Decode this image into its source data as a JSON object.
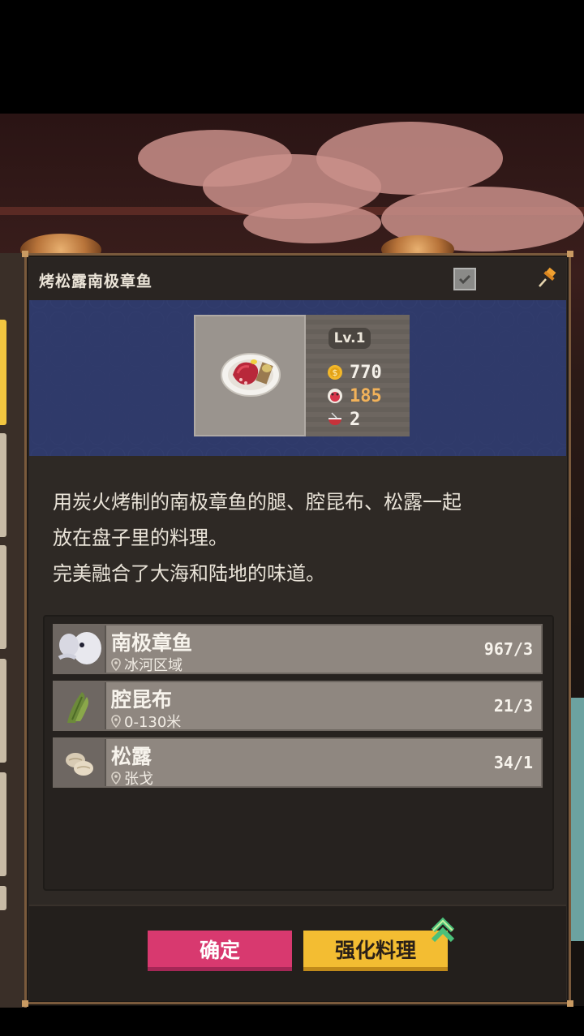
{
  "dish": {
    "title": "烤松露南极章鱼",
    "level": "Lv.1",
    "price": "770",
    "taste": "185",
    "portions": "2"
  },
  "description": [
    "用炭火烤制的南极章鱼的腿、腔昆布、松露一起",
    "放在盘子里的料理。",
    "完美融合了大海和陆地的味道。"
  ],
  "ingredients": [
    {
      "name": "南极章鱼",
      "location": "冰河区域",
      "count": "967/3",
      "icon": "octopus-icon"
    },
    {
      "name": "腔昆布",
      "location": "0-130米",
      "count": "21/3",
      "icon": "seaweed-icon"
    },
    {
      "name": "松露",
      "location": "张戈",
      "count": "34/1",
      "icon": "truffle-icon"
    }
  ],
  "buttons": {
    "confirm": "确定",
    "enhance": "强化料理"
  },
  "colors": {
    "confirm": "#d8396f",
    "enhance": "#f3bd32",
    "taste_value": "#f2b25a",
    "band": "#2f3a6a"
  }
}
